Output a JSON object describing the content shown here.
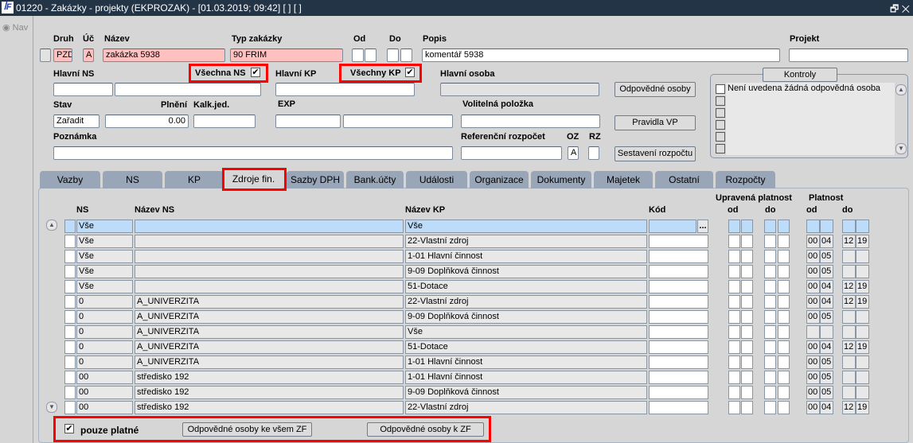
{
  "window": {
    "title": "01220 - Zakázky - projekty (EKPROZAK) - [01.03.2019; 09:42]  [ ]  [ ]",
    "logo": "IF"
  },
  "nav": {
    "label": "Nav"
  },
  "form": {
    "druh_label": "Druh",
    "druh": "PZD",
    "uc_label": "Úč",
    "uc": "A",
    "nazev_label": "Název",
    "nazev": "zakázka 5938",
    "typ_label": "Typ zakázky",
    "typ": "90 FRIM",
    "od_label": "Od",
    "do_label": "Do",
    "popis_label": "Popis",
    "popis": "komentář 5938",
    "projekt_label": "Projekt",
    "hlavni_ns_label": "Hlavní NS",
    "vsechna_ns_label": "Všechna NS",
    "vsechna_ns_checked": true,
    "hlavni_kp_label": "Hlavní KP",
    "vsechny_kp_label": "Všechny KP",
    "vsechny_kp_checked": true,
    "hlavni_osoba_label": "Hlavní osoba",
    "stav_label": "Stav",
    "stav": "Zařadit",
    "plneni_label": "Plnění",
    "plneni": "0.00",
    "kalk_label": "Kalk.jed.",
    "exp_label": "EXP",
    "volitelna_label": "Volitelná položka",
    "poznamka_label": "Poznámka",
    "ref_label": "Referenční rozpočet",
    "oz_label": "OZ",
    "oz": "A",
    "rz_label": "RZ",
    "btn_odpovedne": "Odpovědné osoby",
    "btn_pravidla": "Pravidla VP",
    "btn_sestaveni": "Sestavení rozpočtu"
  },
  "kontroly": {
    "title": "Kontroly",
    "items": [
      "Není uvedena žádná odpovědná osoba",
      "",
      "",
      "",
      "",
      ""
    ]
  },
  "tabs": [
    "Vazby",
    "NS",
    "KP",
    "Zdroje fin.",
    "Sazby DPH",
    "Bank.účty",
    "Události",
    "Organizace",
    "Dokumenty",
    "Majetek",
    "Ostatní",
    "Rozpočty"
  ],
  "active_tab": "Zdroje fin.",
  "grid": {
    "headers": {
      "ns": "NS",
      "nazev_ns": "Název NS",
      "nazev_kp": "Název KP",
      "kod": "Kód",
      "upravena": "Upravená platnost",
      "platnost": "Platnost",
      "od": "od",
      "do": "do"
    },
    "rows": [
      {
        "ns": "Vše",
        "nazev_ns": "",
        "nazev_kp": "Vše",
        "p": [
          "",
          "",
          "",
          ""
        ]
      },
      {
        "ns": "Vše",
        "nazev_ns": "",
        "nazev_kp": "22-Vlastní zdroj",
        "p": [
          "00",
          "04",
          "12",
          "19"
        ]
      },
      {
        "ns": "Vše",
        "nazev_ns": "",
        "nazev_kp": "1-01 Hlavní činnost",
        "p": [
          "00",
          "05",
          "",
          ""
        ]
      },
      {
        "ns": "Vše",
        "nazev_ns": "",
        "nazev_kp": "9-09 Doplňková činnost",
        "p": [
          "00",
          "05",
          "",
          ""
        ]
      },
      {
        "ns": "Vše",
        "nazev_ns": "",
        "nazev_kp": "51-Dotace",
        "p": [
          "00",
          "04",
          "12",
          "19"
        ]
      },
      {
        "ns": "0",
        "nazev_ns": "A_UNIVERZITA",
        "nazev_kp": "22-Vlastní zdroj",
        "p": [
          "00",
          "04",
          "12",
          "19"
        ]
      },
      {
        "ns": "0",
        "nazev_ns": "A_UNIVERZITA",
        "nazev_kp": "9-09 Doplňková činnost",
        "p": [
          "00",
          "05",
          "",
          ""
        ]
      },
      {
        "ns": "0",
        "nazev_ns": "A_UNIVERZITA",
        "nazev_kp": "Vše",
        "p": [
          "",
          "",
          "",
          ""
        ]
      },
      {
        "ns": "0",
        "nazev_ns": "A_UNIVERZITA",
        "nazev_kp": "51-Dotace",
        "p": [
          "00",
          "04",
          "12",
          "19"
        ]
      },
      {
        "ns": "0",
        "nazev_ns": "A_UNIVERZITA",
        "nazev_kp": "1-01 Hlavní činnost",
        "p": [
          "00",
          "05",
          "",
          ""
        ]
      },
      {
        "ns": "00",
        "nazev_ns": "středisko 192",
        "nazev_kp": "1-01 Hlavní činnost",
        "p": [
          "00",
          "05",
          "",
          ""
        ]
      },
      {
        "ns": "00",
        "nazev_ns": "středisko 192",
        "nazev_kp": "9-09 Doplňková činnost",
        "p": [
          "00",
          "05",
          "",
          ""
        ]
      },
      {
        "ns": "00",
        "nazev_ns": "středisko 192",
        "nazev_kp": "22-Vlastní zdroj",
        "p": [
          "00",
          "04",
          "12",
          "19"
        ]
      }
    ],
    "lookup_button": "..."
  },
  "bottom": {
    "pouze_platne_label": "pouze platné",
    "pouze_platne_checked": true,
    "btn_vsem": "Odpovědné osoby ke všem ZF",
    "btn_zf": "Odpovědné osoby k ZF"
  },
  "colors": {
    "highlight": "#ff0000",
    "required": "#ffc0c0",
    "selected_row": "#bcdcfa",
    "titlebar": "#243447"
  }
}
